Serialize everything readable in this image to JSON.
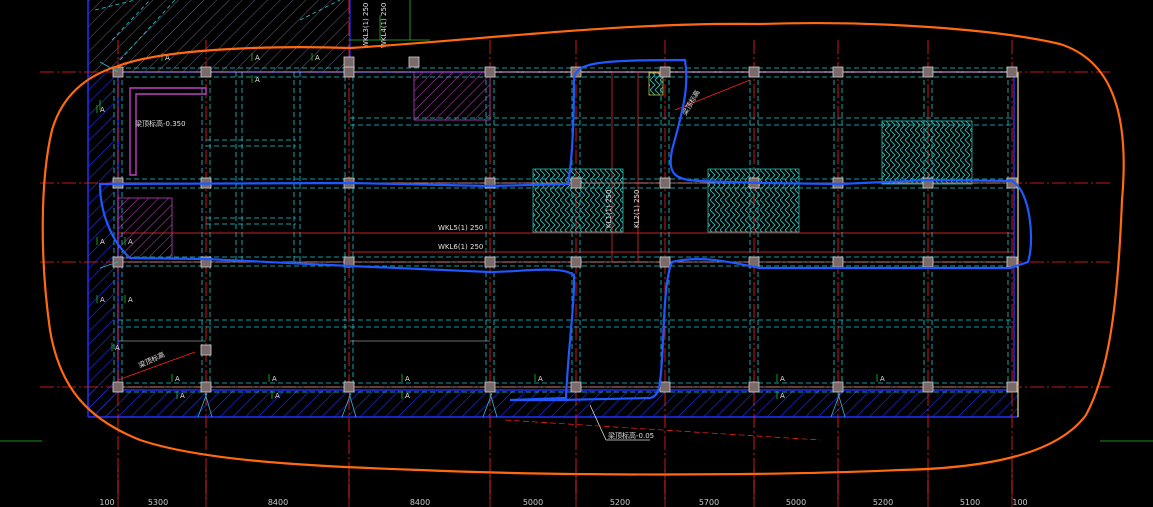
{
  "drawing": {
    "background": "#000000",
    "colors": {
      "axis_line": "#ff2020",
      "beam_cyan": "#20c8d0",
      "beam_white": "#e8e8e8",
      "boundary_blue": "#2030ff",
      "revision_orange": "#ff6a10",
      "markup_blue": "#1e58ff",
      "hatch_magenta": "#c040c0",
      "hatch_cyan": "#30b8b0",
      "column_fill": "#7a6a6a",
      "grid_green": "#20c020",
      "edge_yellow": "#e8d878"
    },
    "dimension_labels": [
      "100",
      "5300",
      "8400",
      "8400",
      "5000",
      "5200",
      "5700",
      "5000",
      "5200",
      "5100",
      "100"
    ],
    "beam_labels": {
      "top_vertical_1": "WKL3(1) 250",
      "top_vertical_2": "WKL4(1) 250",
      "mid_vertical_1": "KL1(1) 250",
      "mid_vertical_2": "KL2(1) 250",
      "horizontal_1": "WKL5(1) 250",
      "horizontal_2": "WKL6(1) 250"
    },
    "leader_notes": {
      "top_middle": "梁顶标高",
      "left_bottom": "梁顶标高",
      "bottom_center": "梁顶标高-0.05"
    },
    "left_note": "梁顶标高-0.350",
    "grid_markers": [
      "A",
      "A",
      "A",
      "A",
      "A",
      "A",
      "A",
      "A",
      "A",
      "A",
      "A",
      "A",
      "A",
      "A",
      "A",
      "A",
      "A",
      "A",
      "A",
      "A"
    ]
  }
}
